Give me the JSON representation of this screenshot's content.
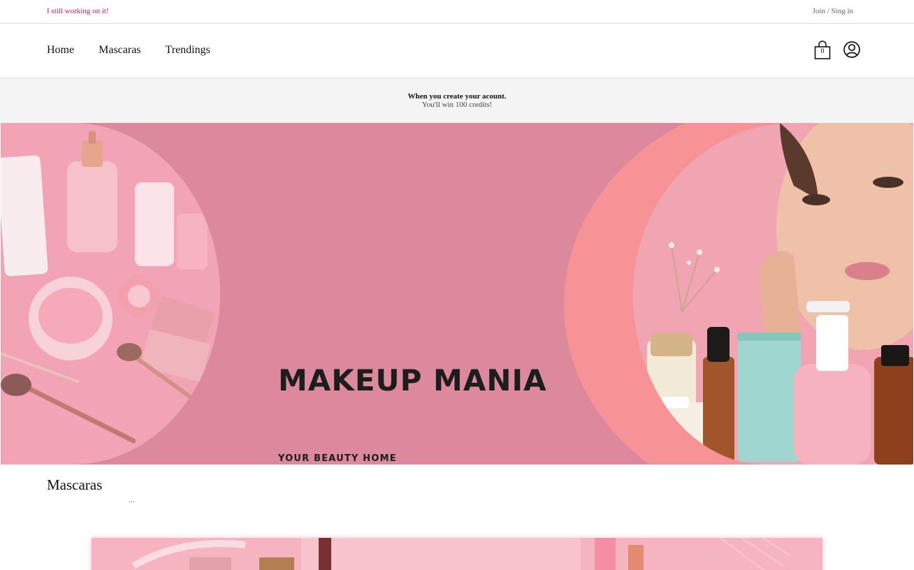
{
  "topbar": {
    "notice": "I still working on it!",
    "account_link": "Join / Sing in"
  },
  "nav": {
    "items": [
      {
        "label": "Home"
      },
      {
        "label": "Mascaras"
      },
      {
        "label": "Trendings"
      }
    ],
    "cart_count": "0",
    "cart_icon": "shopping-bag-icon",
    "user_icon": "user-account-icon"
  },
  "promo": {
    "line1": "When you create your acount.",
    "line2": "You'll win 100 credits!"
  },
  "hero": {
    "title": "MAKEUP MANIA",
    "subtitle": "YOUR BEAUTY HOME",
    "colors": {
      "background": "#dc889d",
      "accent_coral": "#f79396",
      "soft_pink": "#f2a3b5"
    }
  },
  "section": {
    "title": "Mascaras",
    "more": "..."
  }
}
